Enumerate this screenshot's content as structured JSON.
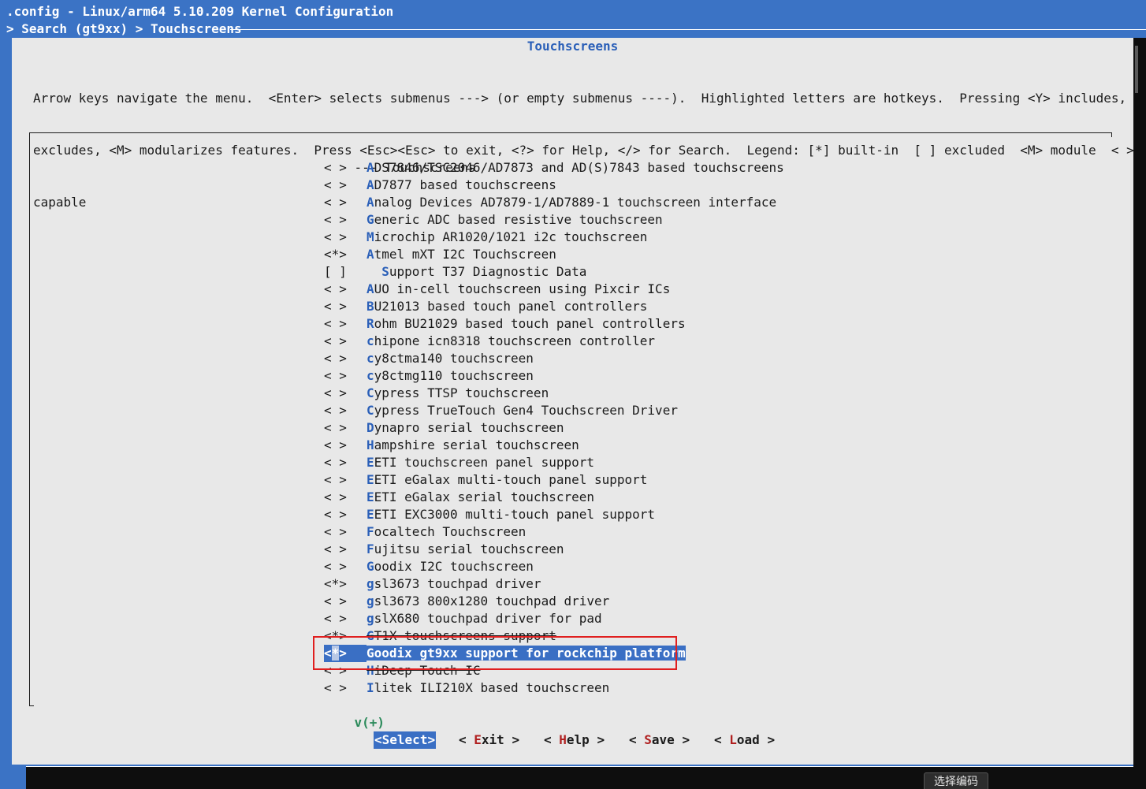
{
  "window": {
    "title": ".config - Linux/arm64 5.10.209 Kernel Configuration",
    "breadcrumb": "> Search (gt9xx) > Touchscreens"
  },
  "dialog": {
    "title": "Touchscreens",
    "help_lines": [
      "Arrow keys navigate the menu.  <Enter> selects submenus ---> (or empty submenus ----).  Highlighted letters are hotkeys.  Pressing <Y> includes, <N>",
      "excludes, <M> modularizes features.  Press <Esc><Esc> to exit, <?> for Help, </> for Search.  Legend: [*] built-in  [ ] excluded  <M> module  < > module",
      "capable"
    ]
  },
  "menu": {
    "header": "--- Touchscreens",
    "items": [
      {
        "state": "< >",
        "hk": "A",
        "rest": "DS7846/TSC2046/AD7873 and AD(S)7843 based touchscreens"
      },
      {
        "state": "< >",
        "hk": "A",
        "rest": "D7877 based touchscreens"
      },
      {
        "state": "< >",
        "hk": "A",
        "rest": "nalog Devices AD7879-1/AD7889-1 touchscreen interface"
      },
      {
        "state": "< >",
        "hk": "G",
        "rest": "eneric ADC based resistive touchscreen"
      },
      {
        "state": "< >",
        "hk": "M",
        "rest": "icrochip AR1020/1021 i2c touchscreen"
      },
      {
        "state": "<*>",
        "hk": "A",
        "rest": "tmel mXT I2C Touchscreen"
      },
      {
        "state": "[ ]",
        "hk": "S",
        "rest": "upport T37 Diagnostic Data",
        "indent": "  "
      },
      {
        "state": "< >",
        "hk": "A",
        "rest": "UO in-cell touchscreen using Pixcir ICs"
      },
      {
        "state": "< >",
        "hk": "B",
        "rest": "U21013 based touch panel controllers"
      },
      {
        "state": "< >",
        "hk": "R",
        "rest": "ohm BU21029 based touch panel controllers"
      },
      {
        "state": "< >",
        "hk": "c",
        "rest": "hipone icn8318 touchscreen controller"
      },
      {
        "state": "< >",
        "hk": "c",
        "rest": "y8ctma140 touchscreen"
      },
      {
        "state": "< >",
        "hk": "c",
        "rest": "y8ctmg110 touchscreen"
      },
      {
        "state": "< >",
        "hk": "C",
        "rest": "ypress TTSP touchscreen"
      },
      {
        "state": "< >",
        "hk": "C",
        "rest": "ypress TrueTouch Gen4 Touchscreen Driver"
      },
      {
        "state": "< >",
        "hk": "D",
        "rest": "ynapro serial touchscreen"
      },
      {
        "state": "< >",
        "hk": "H",
        "rest": "ampshire serial touchscreen"
      },
      {
        "state": "< >",
        "hk": "E",
        "rest": "ETI touchscreen panel support"
      },
      {
        "state": "< >",
        "hk": "E",
        "rest": "ETI eGalax multi-touch panel support"
      },
      {
        "state": "< >",
        "hk": "E",
        "rest": "ETI eGalax serial touchscreen"
      },
      {
        "state": "< >",
        "hk": "E",
        "rest": "ETI EXC3000 multi-touch panel support"
      },
      {
        "state": "< >",
        "hk": "F",
        "rest": "ocaltech Touchscreen"
      },
      {
        "state": "< >",
        "hk": "F",
        "rest": "ujitsu serial touchscreen"
      },
      {
        "state": "< >",
        "hk": "G",
        "rest": "oodix I2C touchscreen"
      },
      {
        "state": "<*>",
        "hk": "g",
        "rest": "sl3673 touchpad driver"
      },
      {
        "state": "< >",
        "hk": "g",
        "rest": "sl3673 800x1280 touchpad driver"
      },
      {
        "state": "< >",
        "hk": "g",
        "rest": "slX680 touchpad driver for pad"
      },
      {
        "state": "<*>",
        "hk": "G",
        "rest": "T1X touchscreens support",
        "strike": true
      },
      {
        "state": "<*>",
        "hk": "G",
        "rest": "oodix gt9xx support for rockchip platform",
        "selected": true
      },
      {
        "state": "< >",
        "hk": "H",
        "rest": "iDeep Touch IC",
        "strike": true
      },
      {
        "state": "< >",
        "hk": "I",
        "rest": "litek ILI210X based touchscreen"
      }
    ],
    "more": "v(+)"
  },
  "buttons": [
    {
      "pre": "<",
      "hk": "S",
      "rest": "elect>",
      "active": true
    },
    {
      "pre": "< ",
      "hk": "E",
      "rest": "xit >"
    },
    {
      "pre": "< ",
      "hk": "H",
      "rest": "elp >"
    },
    {
      "pre": "< ",
      "hk": "S",
      "rest": "ave >"
    },
    {
      "pre": "< ",
      "hk": "L",
      "rest": "oad >"
    }
  ],
  "tooltip": "选择编码"
}
